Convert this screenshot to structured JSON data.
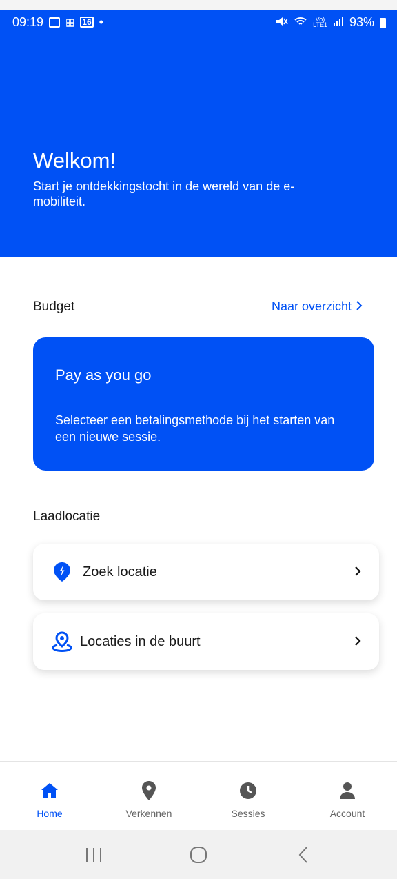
{
  "status": {
    "time": "09:19",
    "left_icons": [
      "gallery-icon",
      "vrt-nws-icon",
      "calendar-icon"
    ],
    "calendar_day": "16",
    "dot": "•",
    "battery": "93%"
  },
  "header": {
    "title": "Welkom!",
    "subtitle": "Start je ontdekkingstocht in de wereld van de e-mobiliteit."
  },
  "budget": {
    "label": "Budget",
    "link": "Naar overzicht",
    "card_title": "Pay as you go",
    "card_text": "Selecteer een betalingsmethode bij het starten van een nieuwe sessie."
  },
  "laadlocatie": {
    "label": "Laadlocatie",
    "items": [
      {
        "label": "Zoek locatie",
        "icon": "charging-location-pin-icon"
      },
      {
        "label": "Locaties in de buurt",
        "icon": "nearby-location-icon"
      }
    ]
  },
  "tabs": [
    {
      "label": "Home",
      "icon": "home-icon",
      "active": true
    },
    {
      "label": "Verkennen",
      "icon": "map-pin-icon",
      "active": false
    },
    {
      "label": "Sessies",
      "icon": "clock-icon",
      "active": false
    },
    {
      "label": "Account",
      "icon": "person-icon",
      "active": false
    }
  ],
  "colors": {
    "primary": "#0051f5",
    "text": "#1a1a1a",
    "tab_inactive": "#666666"
  }
}
